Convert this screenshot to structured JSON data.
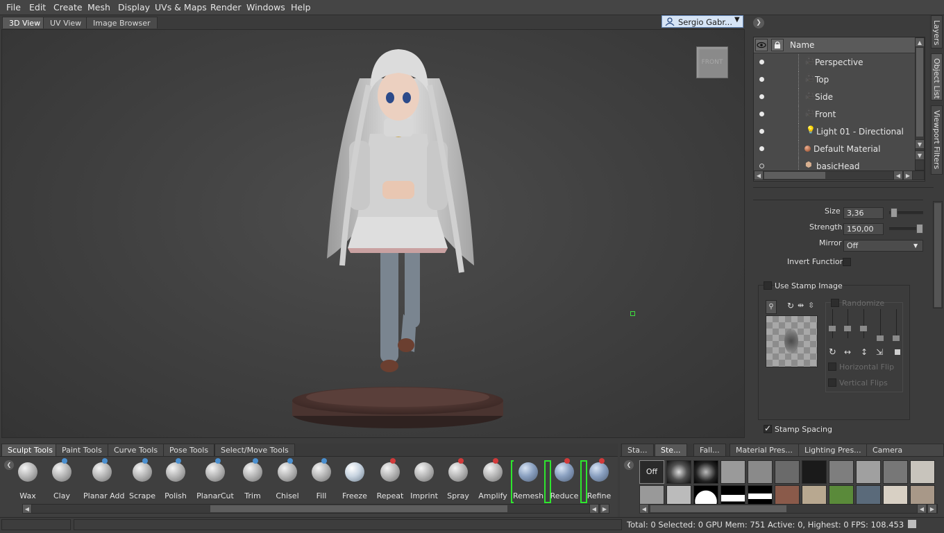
{
  "menu": [
    "File",
    "Edit",
    "Create",
    "Mesh",
    "Display",
    "UVs & Maps",
    "Render",
    "Windows",
    "Help"
  ],
  "view_tabs": [
    "3D View",
    "UV View",
    "Image Browser"
  ],
  "user": {
    "name": "Sergio Gabr...",
    "icon": "user-icon"
  },
  "viewport": {
    "cube_label": "FRONT"
  },
  "right_tabs": [
    "Layers",
    "Object List",
    "Viewport Filters"
  ],
  "object_list": {
    "header": "Name",
    "rows": [
      {
        "label": "Perspective",
        "icon": "camera-icon"
      },
      {
        "label": "Top",
        "icon": "camera-icon"
      },
      {
        "label": "Side",
        "icon": "camera-icon"
      },
      {
        "label": "Front",
        "icon": "camera-icon"
      },
      {
        "label": "Light 01 - Directional",
        "icon": "light-bulb-icon"
      },
      {
        "label": "Default Material",
        "icon": "material-sphere-icon"
      },
      {
        "label": "basicHead",
        "icon": "mesh-icon"
      }
    ]
  },
  "properties": {
    "size_label": "Size",
    "size_value": "3,36",
    "strength_label": "Strength",
    "strength_value": "150,00",
    "mirror_label": "Mirror",
    "mirror_value": "Off",
    "invert_label": "Invert Function",
    "use_stamp_label": "Use Stamp Image",
    "randomize_label": "Randomize",
    "hflip_label": "Horizontal Flip",
    "vflip_label": "Vertical Flips",
    "stamp_spacing_label": "Stamp Spacing"
  },
  "tool_tabs": [
    "Sculpt Tools",
    "Paint Tools",
    "Curve Tools",
    "Pose Tools",
    "Select/Move Tools"
  ],
  "tools": [
    "Wax",
    "Clay",
    "Planar Add",
    "Scrape",
    "Polish",
    "PlanarCut",
    "Trim",
    "Chisel",
    "Fill",
    "Freeze",
    "Repeat",
    "Imprint",
    "Spray",
    "Amplify",
    "Remesh",
    "Reduce",
    "Refine"
  ],
  "stamp_tabs": [
    "Sta...",
    "Ste...",
    "Fall...",
    "Material Pres...",
    "Lighting Pres...",
    "Camera Bookma..."
  ],
  "stamp_off": "Off",
  "status": "Total: 0  Selected: 0 GPU Mem: 751  Active: 0, Highest: 0  FPS: 108.453",
  "colors": {
    "accent_bracket": "#2ee62e",
    "selected_user": "#d6e4f5"
  }
}
